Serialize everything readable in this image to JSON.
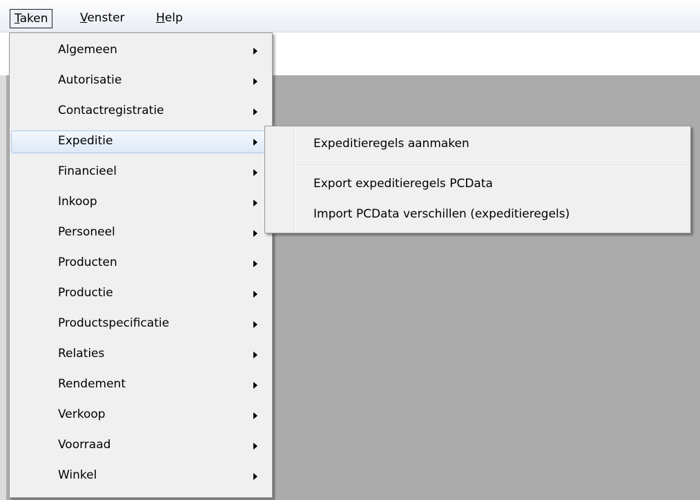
{
  "menubar": {
    "items": [
      {
        "mnemonic": "T",
        "rest": "aken"
      },
      {
        "mnemonic": "V",
        "rest": "enster"
      },
      {
        "mnemonic": "H",
        "rest": "elp"
      }
    ]
  },
  "menu": {
    "items": [
      {
        "label": "Algemeen"
      },
      {
        "label": "Autorisatie"
      },
      {
        "label": "Contactregistratie"
      },
      {
        "label": "Expeditie"
      },
      {
        "label": "Financieel"
      },
      {
        "label": "Inkoop"
      },
      {
        "label": "Personeel"
      },
      {
        "label": "Producten"
      },
      {
        "label": "Productie"
      },
      {
        "label": "Productspecificatie"
      },
      {
        "label": "Relaties"
      },
      {
        "label": "Rendement"
      },
      {
        "label": "Verkoop"
      },
      {
        "label": "Voorraad"
      },
      {
        "label": "Winkel"
      }
    ],
    "highlighted_index": 3
  },
  "submenu": {
    "items": [
      {
        "label": "Expeditieregels aanmaken"
      },
      {
        "label": "Export expeditieregels PCData"
      },
      {
        "label": "Import PCData verschillen (expeditieregels)"
      }
    ]
  }
}
